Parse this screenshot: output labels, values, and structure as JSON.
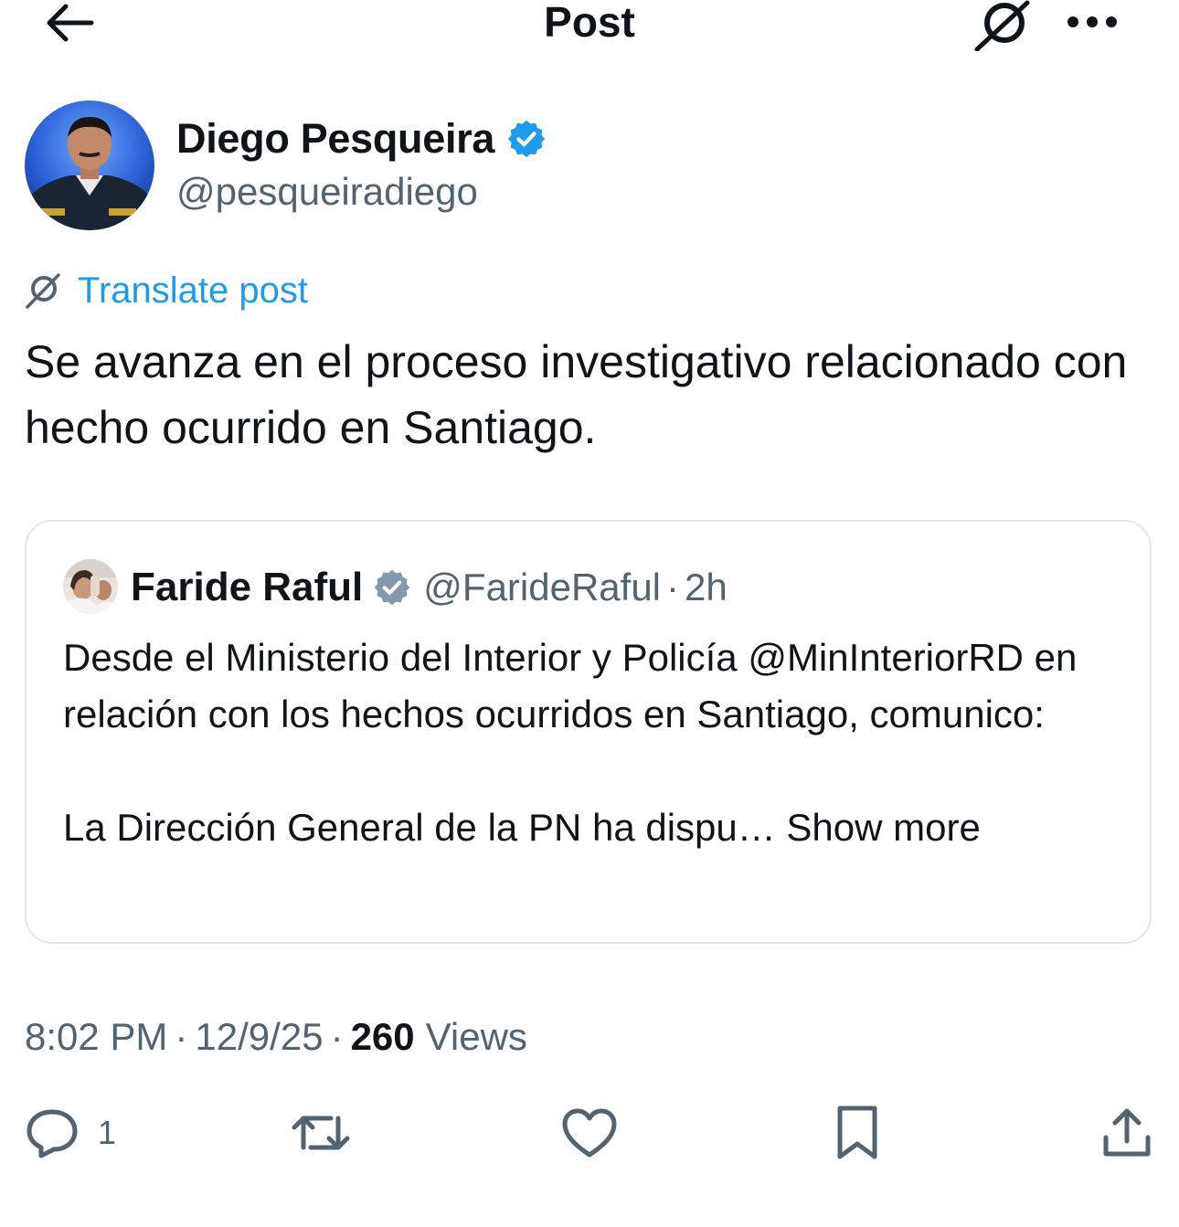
{
  "header": {
    "title": "Post",
    "back_icon": "arrow-left-icon",
    "translate_icon": "translate-icon",
    "more_icon": "more-horizontal-icon"
  },
  "author": {
    "name": "Diego Pesqueira",
    "handle": "@pesqueiradiego",
    "verified": true,
    "verified_color": "#1d9bf0"
  },
  "translate_link": {
    "label": "Translate post",
    "color": "#1d9bf0"
  },
  "post": {
    "text": "Se avanza en el proceso investigativo relacionado con hecho ocurrido en Santiago."
  },
  "quoted_post": {
    "name": "Faride Raful",
    "handle": "@FarideRaful",
    "separator": "·",
    "time": "2h",
    "verified_color": "#829aab",
    "paragraph1": "Desde el Ministerio del Interior y Policía @MinInteriorRD en relación con los hechos ocurridos en Santiago, comunico:",
    "paragraph2": "La Dirección General de la PN ha dispu…",
    "show_more": "Show more"
  },
  "meta": {
    "time": "8:02 PM",
    "separator": "·",
    "date": "12/9/25",
    "views_count": "260",
    "views_label": "Views"
  },
  "actions": {
    "reply_count": "1",
    "icons": [
      "reply-icon",
      "repost-icon",
      "like-icon",
      "bookmark-icon",
      "share-icon"
    ],
    "icon_color": "#536471"
  }
}
